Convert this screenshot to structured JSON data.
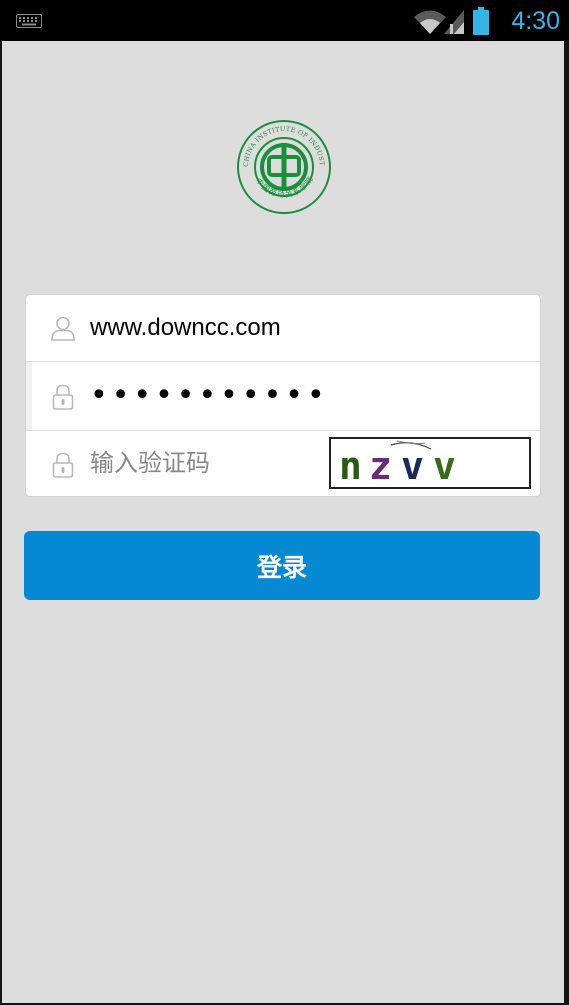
{
  "status_bar": {
    "time": "4:30",
    "icons": [
      "keyboard-icon",
      "wifi-icon",
      "signal-icon",
      "battery-icon"
    ],
    "clock_color": "#33b5e5"
  },
  "logo": {
    "outer_text": "CHINA INSTITUTE OF INDUSTRIAL RELATIONS",
    "inner_text": "中国劳动关系学院",
    "color": "#1a8f3c"
  },
  "login_form": {
    "username": {
      "value": "www.downcc.com",
      "icon": "user-icon"
    },
    "password": {
      "masked_value": "•••••••••••",
      "icon": "lock-icon"
    },
    "captcha": {
      "placeholder": "输入验证码",
      "icon": "lock-icon",
      "image_text": "nzvv"
    }
  },
  "login_button": {
    "label": "登录",
    "color": "#0788d2"
  },
  "colors": {
    "background": "#dddddd",
    "card": "#ffffff"
  }
}
